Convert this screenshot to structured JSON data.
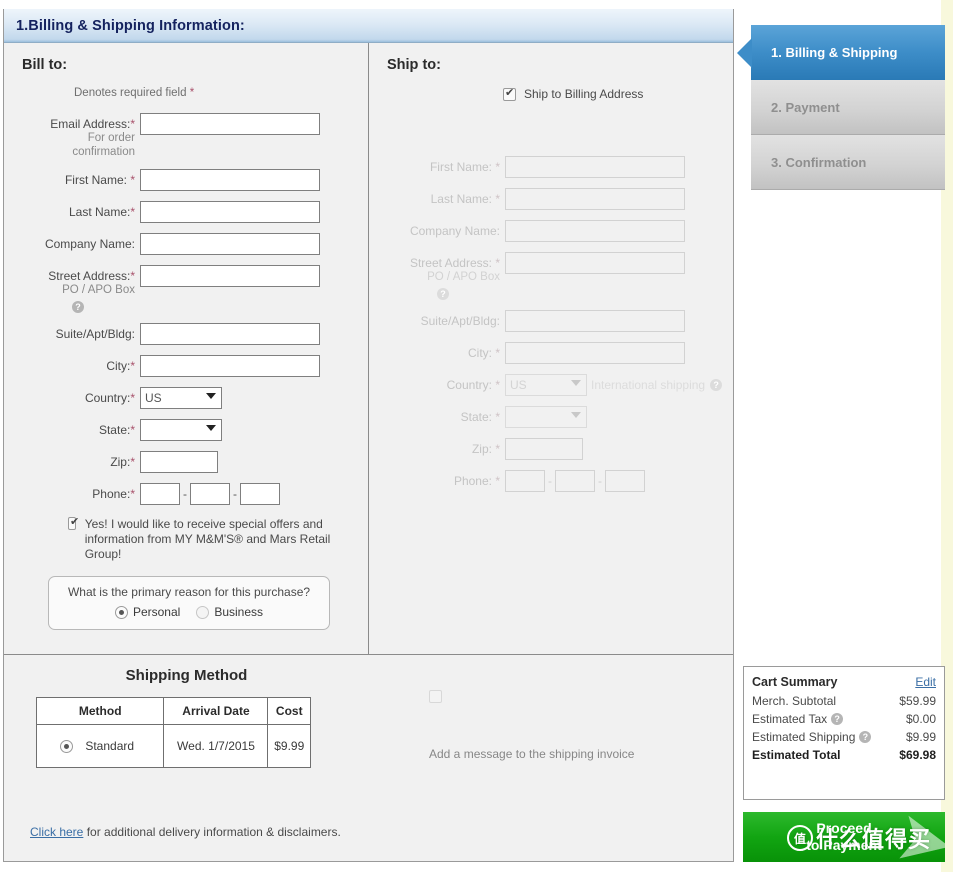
{
  "section": {
    "header_title": "1.Billing & Shipping Information:"
  },
  "bill_to": {
    "title": "Bill to:",
    "denotes_text": "Denotes required field",
    "denotes_star": "*",
    "fields": [
      {
        "label": "Email Address:",
        "req": "*",
        "sub": "For order confirmation",
        "value": "",
        "type": "text"
      },
      {
        "label": "First Name:",
        "req": "*",
        "sub": "",
        "value": "",
        "type": "text"
      },
      {
        "label": "Last Name:",
        "req": "*",
        "sub": "",
        "value": "",
        "type": "text"
      },
      {
        "label": "Company Name:",
        "req": "",
        "sub": "",
        "value": "",
        "type": "text"
      },
      {
        "label": "Street Address:",
        "req": "*",
        "sub": "PO / APO Box",
        "value": "",
        "type": "text"
      },
      {
        "label": "Suite/Apt/Bldg:",
        "req": "",
        "sub": "",
        "value": "",
        "type": "text"
      },
      {
        "label": "City:",
        "req": "*",
        "sub": "",
        "value": "",
        "type": "text"
      },
      {
        "label": "Country:",
        "req": "*",
        "sub": "",
        "value": "US",
        "type": "select"
      },
      {
        "label": "State:",
        "req": "*",
        "sub": "",
        "value": "",
        "type": "select"
      },
      {
        "label": "Zip:",
        "req": "*",
        "sub": "",
        "value": "",
        "type": "zip"
      },
      {
        "label": "Phone:",
        "req": "*",
        "sub": "",
        "value": "",
        "type": "phone"
      }
    ],
    "country_value": "US",
    "state_value": "",
    "help_icon": "question-mark-icon",
    "offers": {
      "checked": true,
      "text": "Yes! I would like to receive special offers and information from MY M&M'S® and Mars Retail Group!"
    },
    "reason": {
      "question": "What is the primary reason for this purchase?",
      "options": [
        {
          "label": "Personal",
          "selected": true
        },
        {
          "label": "Business",
          "selected": false
        }
      ]
    }
  },
  "ship_to": {
    "title": "Ship to:",
    "same_as_billing": {
      "label": "Ship to Billing Address",
      "checked": true
    },
    "disabled": true,
    "fields": [
      {
        "label": "First Name:",
        "req": "*",
        "sub": "",
        "value": "",
        "type": "text"
      },
      {
        "label": "Last Name:",
        "req": "*",
        "sub": "",
        "value": "",
        "type": "text"
      },
      {
        "label": "Company Name:",
        "req": "",
        "sub": "",
        "value": "",
        "type": "text"
      },
      {
        "label": "Street Address:",
        "req": "*",
        "sub": "PO / APO Box",
        "value": "",
        "type": "text"
      },
      {
        "label": "Suite/Apt/Bldg:",
        "req": "",
        "sub": "",
        "value": "",
        "type": "text"
      },
      {
        "label": "City:",
        "req": "*",
        "sub": "",
        "value": "",
        "type": "text"
      },
      {
        "label": "Country:",
        "req": "*",
        "sub": "",
        "value": "US",
        "type": "select"
      },
      {
        "label": "State:",
        "req": "*",
        "sub": "",
        "value": "",
        "type": "select"
      },
      {
        "label": "Zip:",
        "req": "*",
        "sub": "",
        "value": "",
        "type": "zip"
      },
      {
        "label": "Phone:",
        "req": "*",
        "sub": "",
        "value": "",
        "type": "phone"
      }
    ],
    "country_value": "US",
    "state_value": "",
    "international_note": "International shipping"
  },
  "shipping_method": {
    "heading": "Shipping Method",
    "columns": [
      "Method",
      "Arrival Date",
      "Cost"
    ],
    "rows": [
      {
        "method": "Standard",
        "selected": true,
        "arrival": "Wed. 1/7/2015",
        "cost": "$9.99"
      }
    ],
    "invoice_message": {
      "checked": false,
      "label": "Add a message to the shipping invoice"
    },
    "disclaimer_link": "Click here",
    "disclaimer_text": "for additional delivery information & disclaimers."
  },
  "steps": [
    {
      "label": "1. Billing & Shipping",
      "state": "active"
    },
    {
      "label": "2. Payment",
      "state": "idle"
    },
    {
      "label": "3. Confirmation",
      "state": "idle"
    }
  ],
  "cart": {
    "title": "Cart Summary",
    "edit_label": "Edit",
    "lines": [
      {
        "label": "Merch. Subtotal",
        "amount": "$59.99",
        "help": false
      },
      {
        "label": "Estimated Tax",
        "amount": "$0.00",
        "help": true
      },
      {
        "label": "Estimated Shipping",
        "amount": "$9.99",
        "help": true
      },
      {
        "label": "Estimated Total",
        "amount": "$69.98",
        "help": false,
        "bold": true
      }
    ]
  },
  "proceed_button": {
    "line1": "Proceed",
    "line2": "to Payment"
  },
  "watermark": {
    "badge": "值",
    "text": "什么值得买"
  },
  "colors": {
    "accent_blue": "#3d8dc8",
    "proceed_green": "#12a512",
    "required_star": "#a8516b",
    "link_blue": "#3a6ea5",
    "right_strip": "#f8f8dc"
  }
}
